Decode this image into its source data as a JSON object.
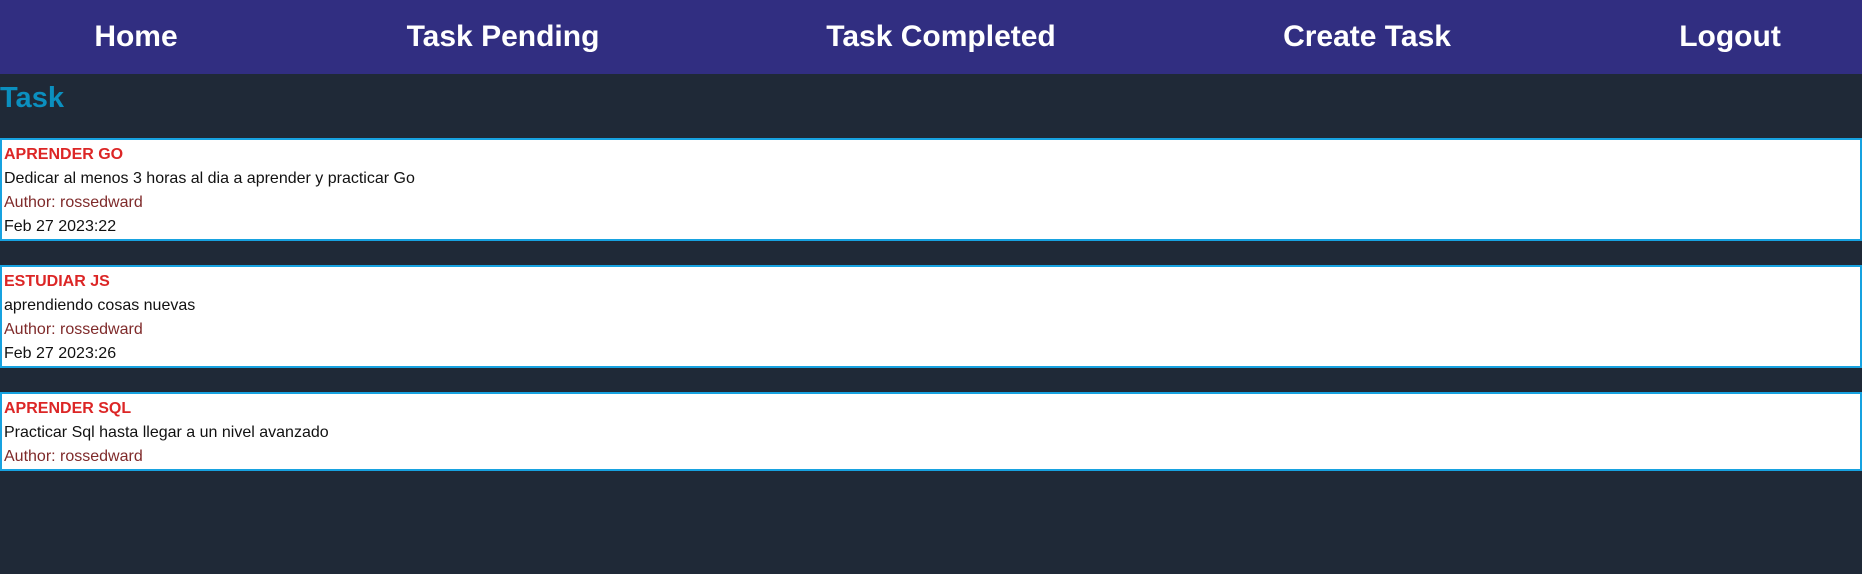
{
  "nav": {
    "items": [
      {
        "label": "Home"
      },
      {
        "label": "Task Pending"
      },
      {
        "label": "Task Completed"
      },
      {
        "label": "Create Task"
      },
      {
        "label": "Logout"
      }
    ]
  },
  "page": {
    "title": "Task"
  },
  "tasks": [
    {
      "title": "APRENDER GO",
      "description": "Dedicar al menos 3 horas al dia a aprender y practicar Go",
      "author": "Author: rossedward",
      "date": "Feb 27 2023:22"
    },
    {
      "title": "ESTUDIAR JS",
      "description": "aprendiendo cosas nuevas",
      "author": "Author: rossedward",
      "date": "Feb 27 2023:26"
    },
    {
      "title": "APRENDER SQL",
      "description": "Practicar Sql hasta llegar a un nivel avanzado",
      "author": "Author: rossedward"
    }
  ],
  "colors": {
    "navbar_bg": "#312e81",
    "page_bg": "#1f2937",
    "title_accent": "#0b8fbf",
    "task_title": "#dc2626",
    "card_border": "#17a2e0"
  }
}
